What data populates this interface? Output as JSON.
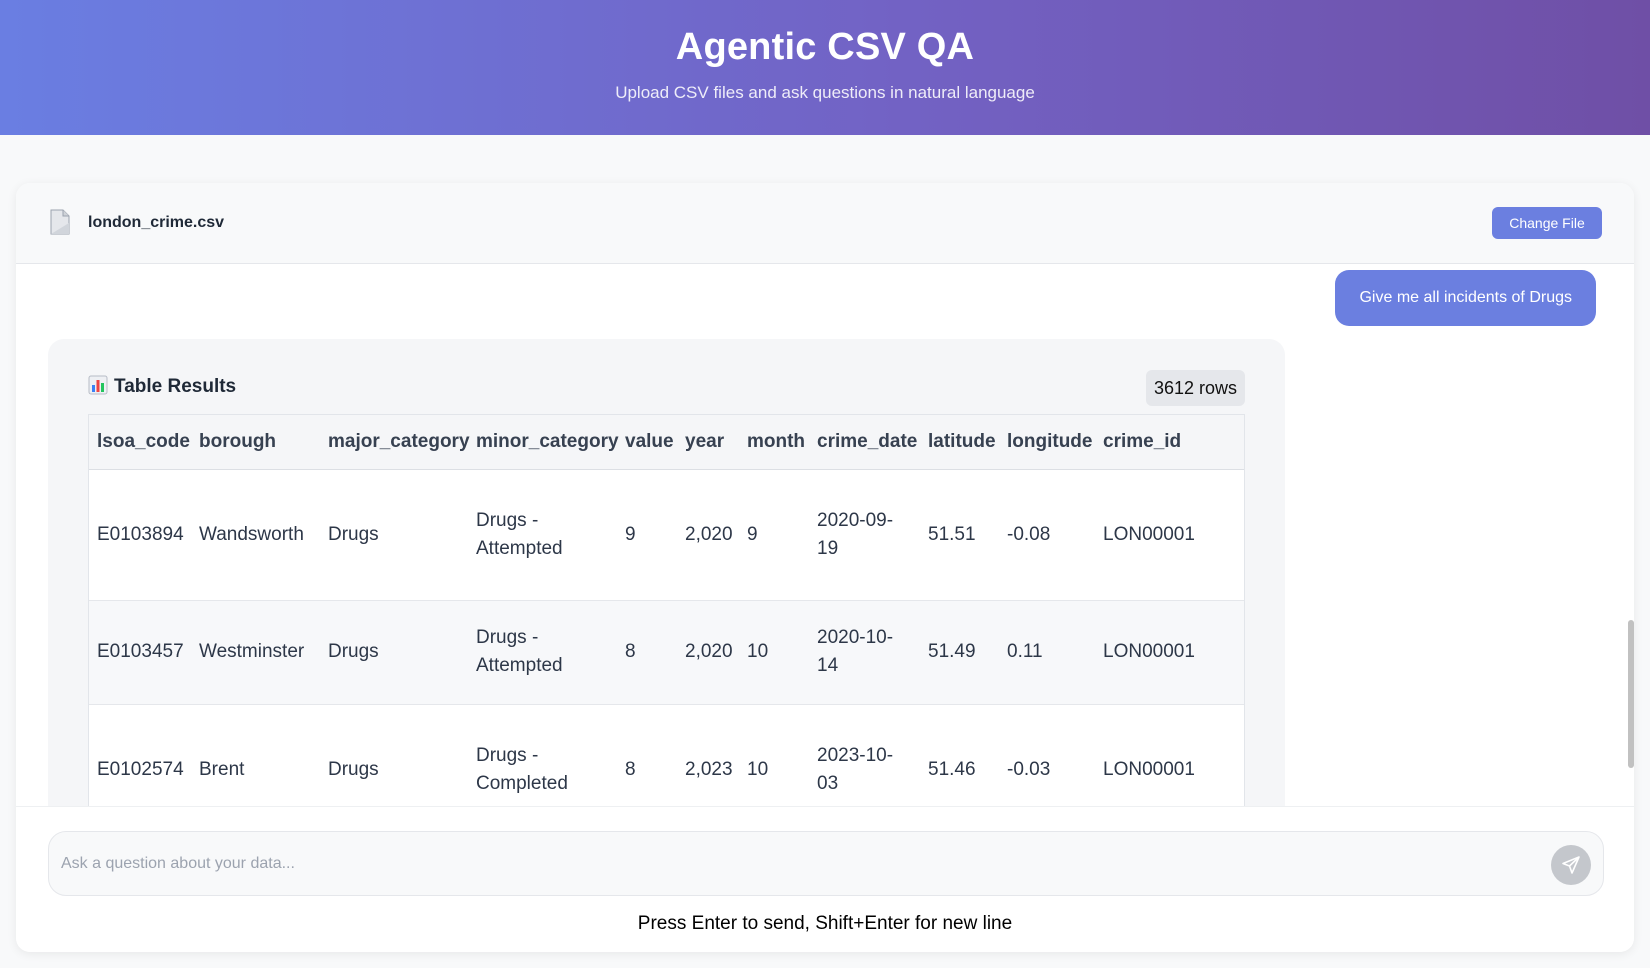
{
  "header": {
    "title": "Agentic CSV QA",
    "subtitle": "Upload CSV files and ask questions in natural language"
  },
  "file": {
    "name": "london_crime.csv",
    "icon": "file-icon",
    "change_label": "Change File"
  },
  "chat": {
    "user_message": "Give me all incidents of Drugs",
    "result": {
      "title": "Table Results",
      "icon": "bar-chart-icon",
      "rows_label": "3612 rows",
      "columns": [
        "lsoa_code",
        "borough",
        "major_category",
        "minor_category",
        "value",
        "year",
        "month",
        "crime_date",
        "latitude",
        "longitude",
        "crime_id"
      ],
      "rows": [
        [
          "E0103894",
          "Wandsworth",
          "Drugs",
          "Drugs - Attempted",
          "9",
          "2,020",
          "9",
          "2020-09-19",
          "51.51",
          "-0.08",
          "LON00001"
        ],
        [
          "E0103457",
          "Westminster",
          "Drugs",
          "Drugs - Attempted",
          "8",
          "2,020",
          "10",
          "2020-10-14",
          "51.49",
          "0.11",
          "LON00001"
        ],
        [
          "E0102574",
          "Brent",
          "Drugs",
          "Drugs - Completed",
          "8",
          "2,023",
          "10",
          "2023-10-03",
          "51.46",
          "-0.03",
          "LON00001"
        ]
      ]
    }
  },
  "input": {
    "placeholder": "Ask a question about your data...",
    "hint": "Press Enter to send, Shift+Enter for new line"
  },
  "colors": {
    "accent": "#6b7fe0",
    "header_gradient_start": "#6a7ee2",
    "header_gradient_end": "#6f4fa6"
  }
}
